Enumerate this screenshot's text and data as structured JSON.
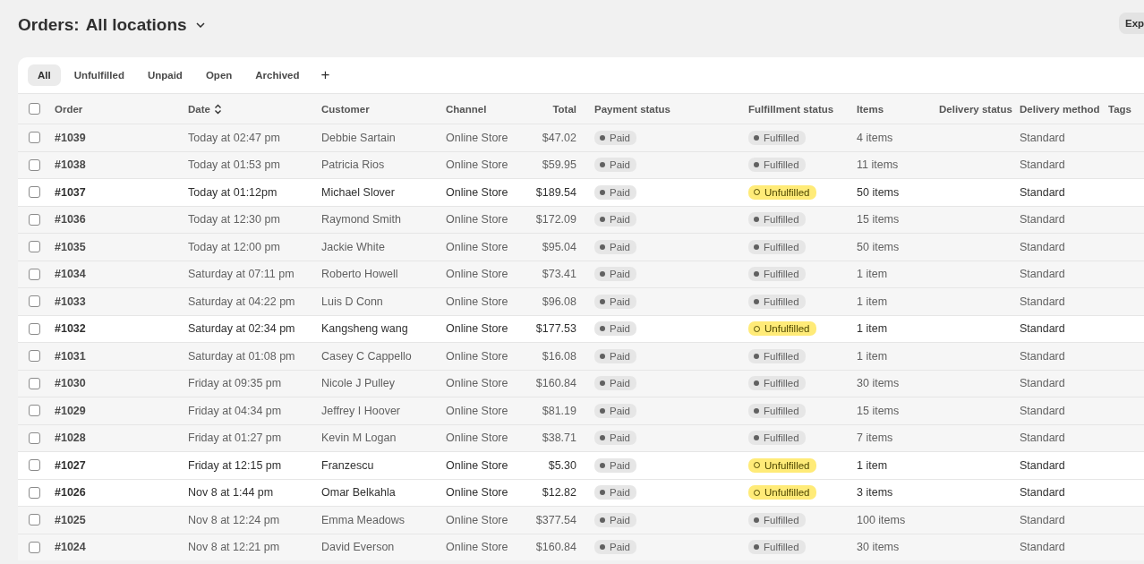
{
  "header": {
    "title": "Orders:",
    "location": "All locations",
    "export_button": "Exp"
  },
  "tabs": [
    {
      "label": "All",
      "selected": true
    },
    {
      "label": "Unfulfilled",
      "selected": false
    },
    {
      "label": "Unpaid",
      "selected": false
    },
    {
      "label": "Open",
      "selected": false
    },
    {
      "label": "Archived",
      "selected": false
    }
  ],
  "add_tab": "+",
  "table": {
    "columns": [
      "Order",
      "Date",
      "Customer",
      "Channel",
      "Total",
      "Payment status",
      "Fulfillment status",
      "Items",
      "Delivery status",
      "Delivery method",
      "Tags"
    ],
    "select_all_checked": false,
    "rows": [
      {
        "checked": false,
        "order": "#1039",
        "date": "Today at 02:47 pm",
        "customer": "Debbie Sartain",
        "channel": "Online Store",
        "total": "$47.02",
        "payment": "Paid",
        "fulfillment": {
          "label": "Fulfilled",
          "kind": "fulfilled"
        },
        "items": "4 items",
        "delivery_method": "Standard"
      },
      {
        "checked": false,
        "order": "#1038",
        "date": "Today at 01:53 pm",
        "customer": "Patricia Rios",
        "channel": "Online Store",
        "total": "$59.95",
        "payment": "Paid",
        "fulfillment": {
          "label": "Fulfilled",
          "kind": "fulfilled"
        },
        "items": "11 items",
        "delivery_method": "Standard"
      },
      {
        "checked": false,
        "order": "#1037",
        "date": "Today at 01:12pm",
        "customer": "Michael Slover",
        "channel": "Online Store",
        "total": "$189.54",
        "payment": "Paid",
        "fulfillment": {
          "label": "Unfulfilled",
          "kind": "unfulfilled"
        },
        "items": "50 items",
        "delivery_method": "Standard"
      },
      {
        "checked": false,
        "order": "#1036",
        "date": "Today at 12:30 pm",
        "customer": "Raymond Smith",
        "channel": "Online Store",
        "total": "$172.09",
        "payment": "Paid",
        "fulfillment": {
          "label": "Fulfilled",
          "kind": "fulfilled"
        },
        "items": "15 items",
        "delivery_method": "Standard"
      },
      {
        "checked": false,
        "order": "#1035",
        "date": "Today at 12:00 pm",
        "customer": "Jackie White",
        "channel": "Online Store",
        "total": "$95.04",
        "payment": "Paid",
        "fulfillment": {
          "label": "Fulfilled",
          "kind": "fulfilled"
        },
        "items": "50 items",
        "delivery_method": "Standard"
      },
      {
        "checked": false,
        "order": "#1034",
        "date": "Saturday at 07:11 pm",
        "customer": "Roberto Howell",
        "channel": "Online Store",
        "total": "$73.41",
        "payment": "Paid",
        "fulfillment": {
          "label": "Fulfilled",
          "kind": "fulfilled"
        },
        "items": "1 item",
        "delivery_method": "Standard"
      },
      {
        "checked": false,
        "order": "#1033",
        "date": "Saturday at 04:22 pm",
        "customer": "Luis D Conn",
        "channel": "Online Store",
        "total": "$96.08",
        "payment": "Paid",
        "fulfillment": {
          "label": "Fulfilled",
          "kind": "fulfilled"
        },
        "items": "1 item",
        "delivery_method": "Standard"
      },
      {
        "checked": false,
        "order": "#1032",
        "date": "Saturday at 02:34 pm",
        "customer": "Kangsheng wang",
        "channel": "Online Store",
        "total": "$177.53",
        "payment": "Paid",
        "fulfillment": {
          "label": "Unfulfilled",
          "kind": "unfulfilled"
        },
        "items": "1 item",
        "delivery_method": "Standard"
      },
      {
        "checked": false,
        "order": "#1031",
        "date": "Saturday at 01:08 pm",
        "customer": "Casey C Cappello",
        "channel": "Online Store",
        "total": "$16.08",
        "payment": "Paid",
        "fulfillment": {
          "label": "Fulfilled",
          "kind": "fulfilled"
        },
        "items": "1 item",
        "delivery_method": "Standard"
      },
      {
        "checked": false,
        "order": "#1030",
        "date": "Friday at 09:35 pm",
        "customer": "Nicole J Pulley",
        "channel": "Online Store",
        "total": "$160.84",
        "payment": "Paid",
        "fulfillment": {
          "label": "Fulfilled",
          "kind": "fulfilled"
        },
        "items": "30 items",
        "delivery_method": "Standard"
      },
      {
        "checked": false,
        "order": "#1029",
        "date": "Friday at 04:34 pm",
        "customer": "Jeffrey I Hoover",
        "channel": "Online Store",
        "total": "$81.19",
        "payment": "Paid",
        "fulfillment": {
          "label": "Fulfilled",
          "kind": "fulfilled"
        },
        "items": "15 items",
        "delivery_method": "Standard"
      },
      {
        "checked": false,
        "order": "#1028",
        "date": "Friday at 01:27 pm",
        "customer": "Kevin M Logan",
        "channel": "Online Store",
        "total": "$38.71",
        "payment": "Paid",
        "fulfillment": {
          "label": "Fulfilled",
          "kind": "fulfilled"
        },
        "items": "7 items",
        "delivery_method": "Standard"
      },
      {
        "checked": false,
        "order": "#1027",
        "date": "Friday at 12:15 pm",
        "customer": "Franzescu",
        "channel": "Online Store",
        "total": "$5.30",
        "payment": "Paid",
        "fulfillment": {
          "label": "Unfulfilled",
          "kind": "unfulfilled"
        },
        "items": "1 item",
        "delivery_method": "Standard"
      },
      {
        "checked": false,
        "order": "#1026",
        "date": "Nov 8 at 1:44 pm",
        "customer": "Omar Belkahla",
        "channel": "Online Store",
        "total": "$12.82",
        "payment": "Paid",
        "fulfillment": {
          "label": "Unfulfilled",
          "kind": "unfulfilled"
        },
        "items": "3 items",
        "delivery_method": "Standard"
      },
      {
        "checked": false,
        "order": "#1025",
        "date": "Nov 8 at 12:24 pm",
        "customer": "Emma Meadows",
        "channel": "Online Store",
        "total": "$377.54",
        "payment": "Paid",
        "fulfillment": {
          "label": "Fulfilled",
          "kind": "fulfilled"
        },
        "items": "100 items",
        "delivery_method": "Standard"
      },
      {
        "checked": false,
        "order": "#1024",
        "date": "Nov 8 at 12:21 pm",
        "customer": "David Everson",
        "channel": "Online Store",
        "total": "$160.84",
        "payment": "Paid",
        "fulfillment": {
          "label": "Fulfilled",
          "kind": "fulfilled"
        },
        "items": "30 items",
        "delivery_method": "Standard"
      }
    ]
  }
}
